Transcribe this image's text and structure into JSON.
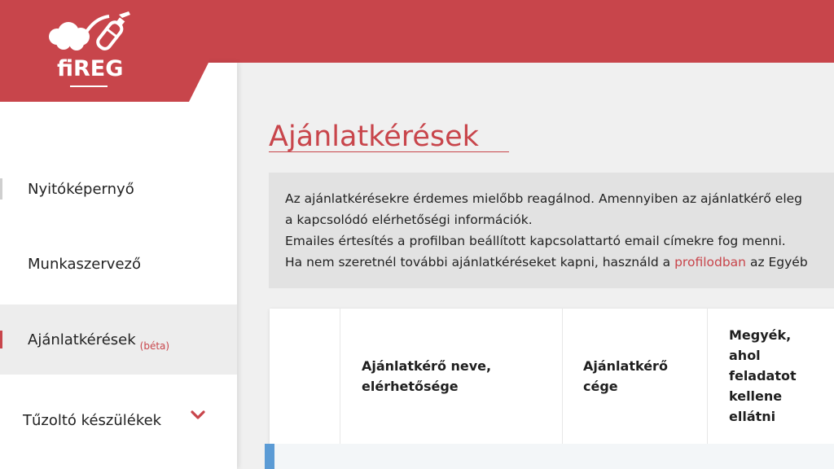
{
  "brand": {
    "name": "fiREG"
  },
  "sidebar": {
    "items": [
      {
        "label": "Nyitóképernyő"
      },
      {
        "label": "Munkaszervező"
      },
      {
        "label": "Ajánlatkérések",
        "badge": "(béta)"
      },
      {
        "label": "Tűzoltó készülékek"
      }
    ]
  },
  "main": {
    "title": "Ajánlatkérések",
    "info": {
      "line1": "Az ajánlatkérésekre érdemes mielőbb reagálnod. Amennyiben az ajánlatkérő eleg",
      "line2": "a kapcsolódó elérhetőségi információk.",
      "line3": "Emailes értesítés a profilban beállított kapcsolattartó email címekre fog menni.",
      "line4_before": "Ha nem szeretnél további ajánlatkéréseket kapni, használd a ",
      "line4_link": "profilodban",
      "line4_after": " az Egyéb"
    },
    "table": {
      "headers": [
        {
          "line1": "Ajánlatkérő neve,",
          "line2": "elérhetősége"
        },
        {
          "line1": "Ajánlatkérő",
          "line2": "cége"
        },
        {
          "line1": "Megyék,",
          "line2": "ahol",
          "line3": "feladatot",
          "line4": "kellene",
          "line5": "ellátni"
        }
      ]
    }
  },
  "colors": {
    "brand_red": "#c8454b",
    "row_marker_blue": "#5b9bd5"
  },
  "icons": {
    "logo": "fire-extinguisher-icon",
    "expand": "chevron-down-icon"
  }
}
